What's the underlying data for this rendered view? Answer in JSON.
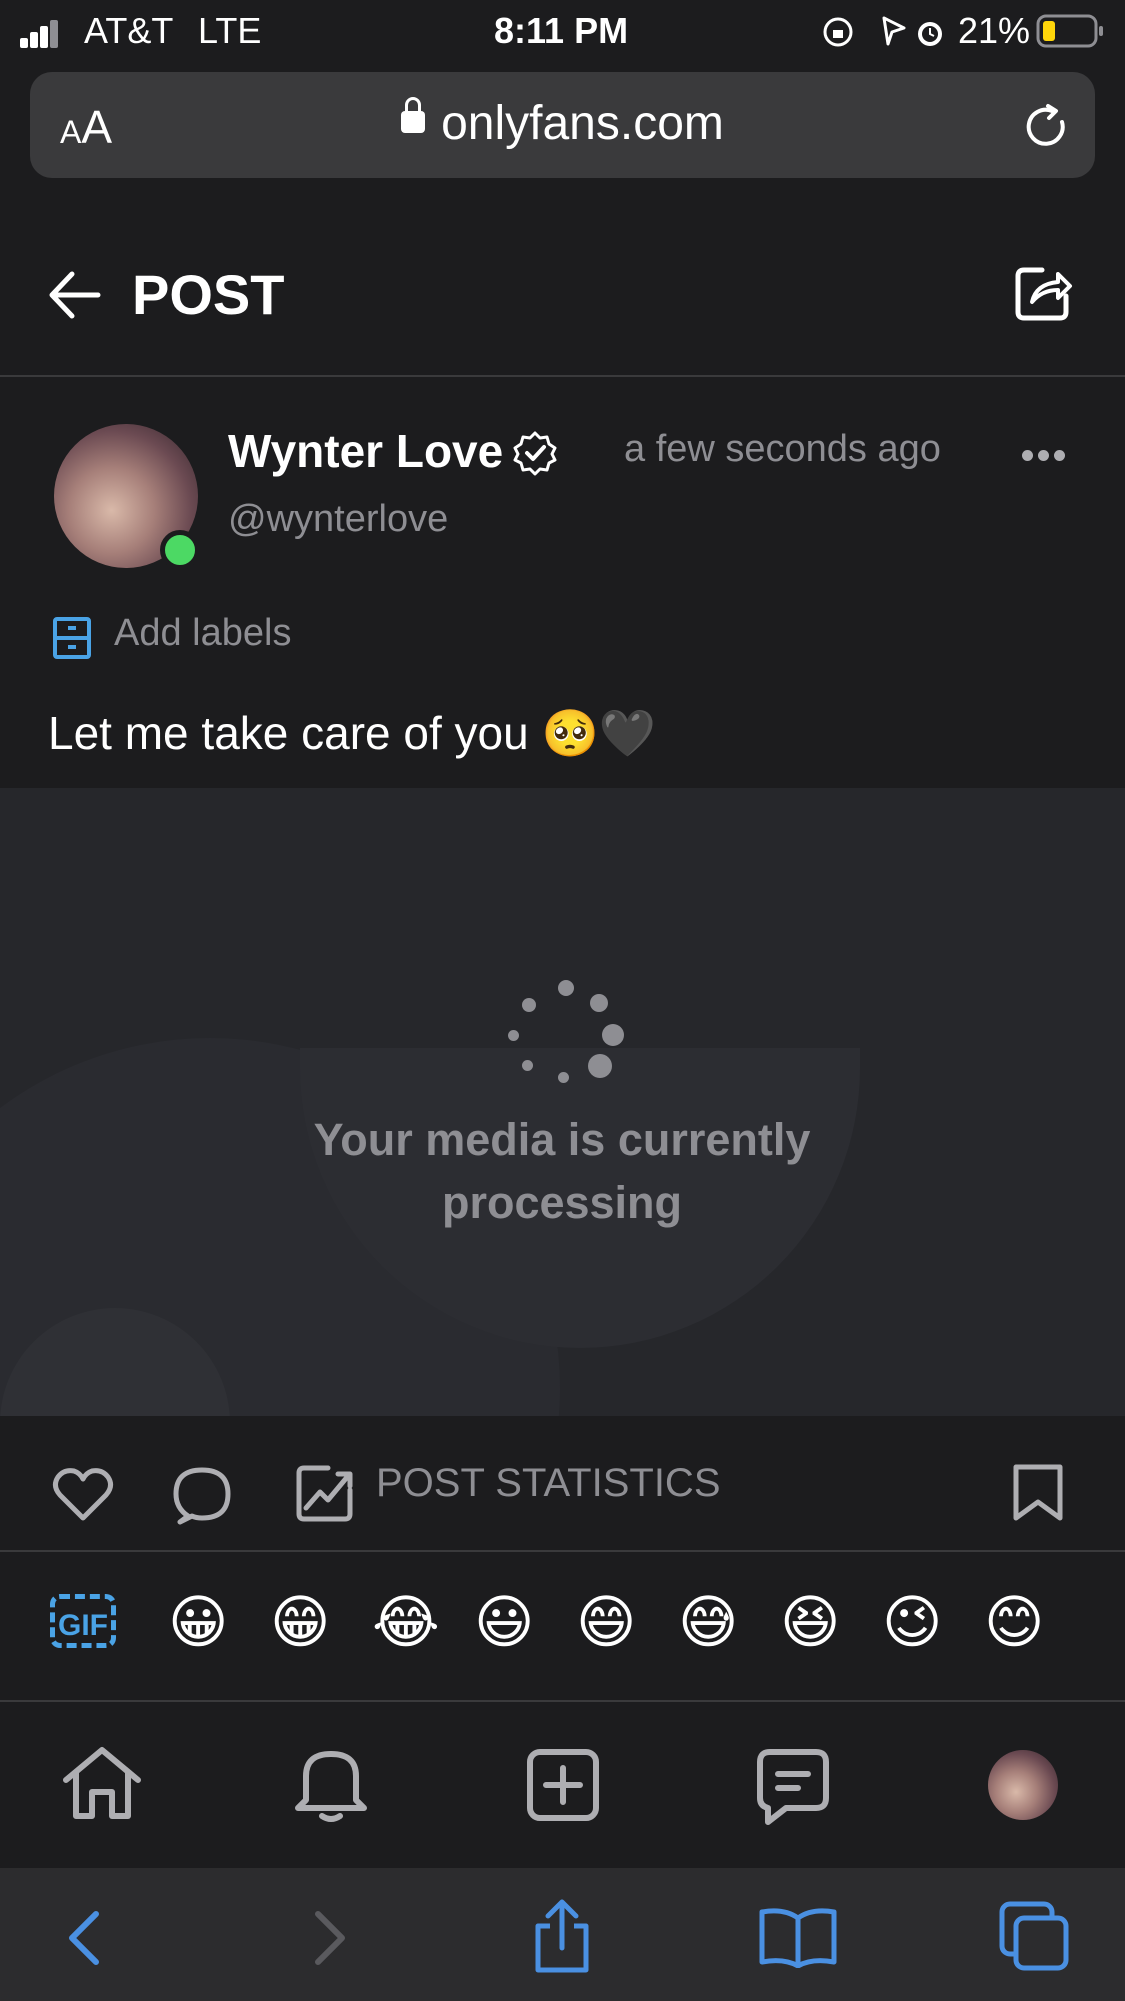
{
  "status_bar": {
    "carrier": "AT&T",
    "network": "LTE",
    "time": "8:11 PM",
    "battery": "21%"
  },
  "browser": {
    "text_size_small": "A",
    "text_size_large": "A",
    "url": "onlyfans.com"
  },
  "header": {
    "title": "POST"
  },
  "post": {
    "author_name": "Wynter Love",
    "author_handle": "@wynterlove",
    "timestamp": "a few seconds ago",
    "add_labels": "Add labels",
    "caption": "Let me take care of you 🥺🖤",
    "media_status": "Your media is currently processing"
  },
  "actions": {
    "statistics_label": "POST STATISTICS"
  },
  "emoji_bar": {
    "gif_label": "GIF",
    "emojis": [
      "😀",
      "😁",
      "😂",
      "😃",
      "😄",
      "😅",
      "😆",
      "😉",
      "😊"
    ]
  },
  "colors": {
    "background": "#1c1c1e",
    "accent": "#4aa3e6",
    "muted": "#8e8e93",
    "online": "#4cd964",
    "safari_blue": "#4a90e2",
    "battery_low": "#ffd60a"
  }
}
